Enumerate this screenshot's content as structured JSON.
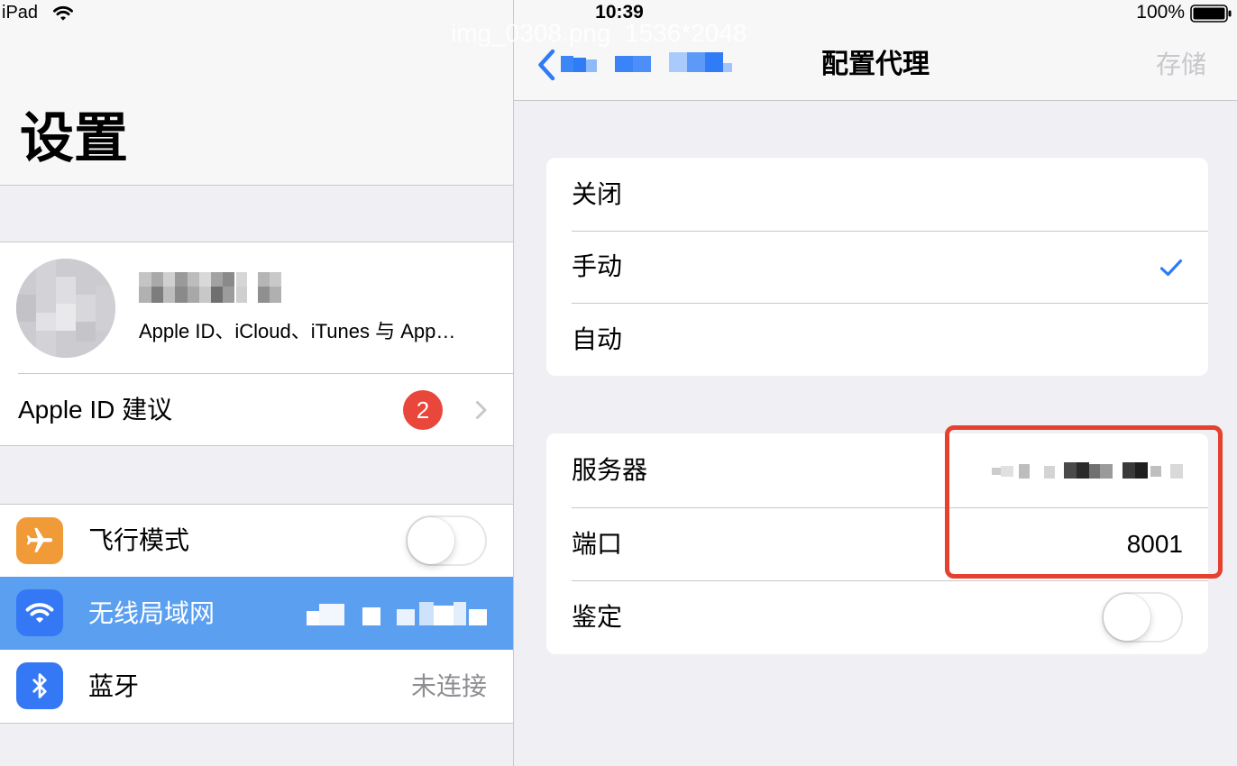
{
  "status_bar": {
    "device": "iPad",
    "time": "10:39",
    "battery": "100%",
    "wifi_icon": "wifi-icon",
    "battery_icon": "battery-icon"
  },
  "watermark": "img_0308.png  1536*2048",
  "colors": {
    "accent": "#2f7cf6",
    "selected_row": "#5b9ff0",
    "badge": "#e9473b",
    "annotation": "#e5412f",
    "secondary_text": "#8e8e93",
    "disabled_text": "#c7c7cc",
    "grouped_background": "#efeff4",
    "bar_background": "#f7f7f7"
  },
  "sidebar": {
    "title": "设置",
    "profile": {
      "subtitle": "Apple ID、iCloud、iTunes 与 App…"
    },
    "apple_id_suggestions": {
      "label": "Apple ID 建议",
      "badge": "2",
      "chevron_icon": "chevron-right-icon"
    },
    "items": [
      {
        "label": "飞行模式",
        "icon": "airplane-icon",
        "icon_color": "#f19a38",
        "toggle_on": false
      },
      {
        "label": "无线局域网",
        "icon": "wifi-icon",
        "icon_color": "#3478f6",
        "selected": true
      },
      {
        "label": "蓝牙",
        "icon": "bluetooth-icon",
        "icon_color": "#3478f6",
        "value": "未连接"
      }
    ]
  },
  "detail": {
    "nav": {
      "back_icon": "chevron-left-icon",
      "title": "配置代理",
      "save_label": "存储",
      "save_enabled": false
    },
    "proxy_modes": [
      {
        "label": "关闭",
        "checked": false
      },
      {
        "label": "手动",
        "checked": true
      },
      {
        "label": "自动",
        "checked": false
      }
    ],
    "proxy_settings": {
      "server": {
        "label": "服务器"
      },
      "port": {
        "label": "端口",
        "value": "8001"
      },
      "authentication": {
        "label": "鉴定",
        "toggle_on": false
      }
    }
  }
}
